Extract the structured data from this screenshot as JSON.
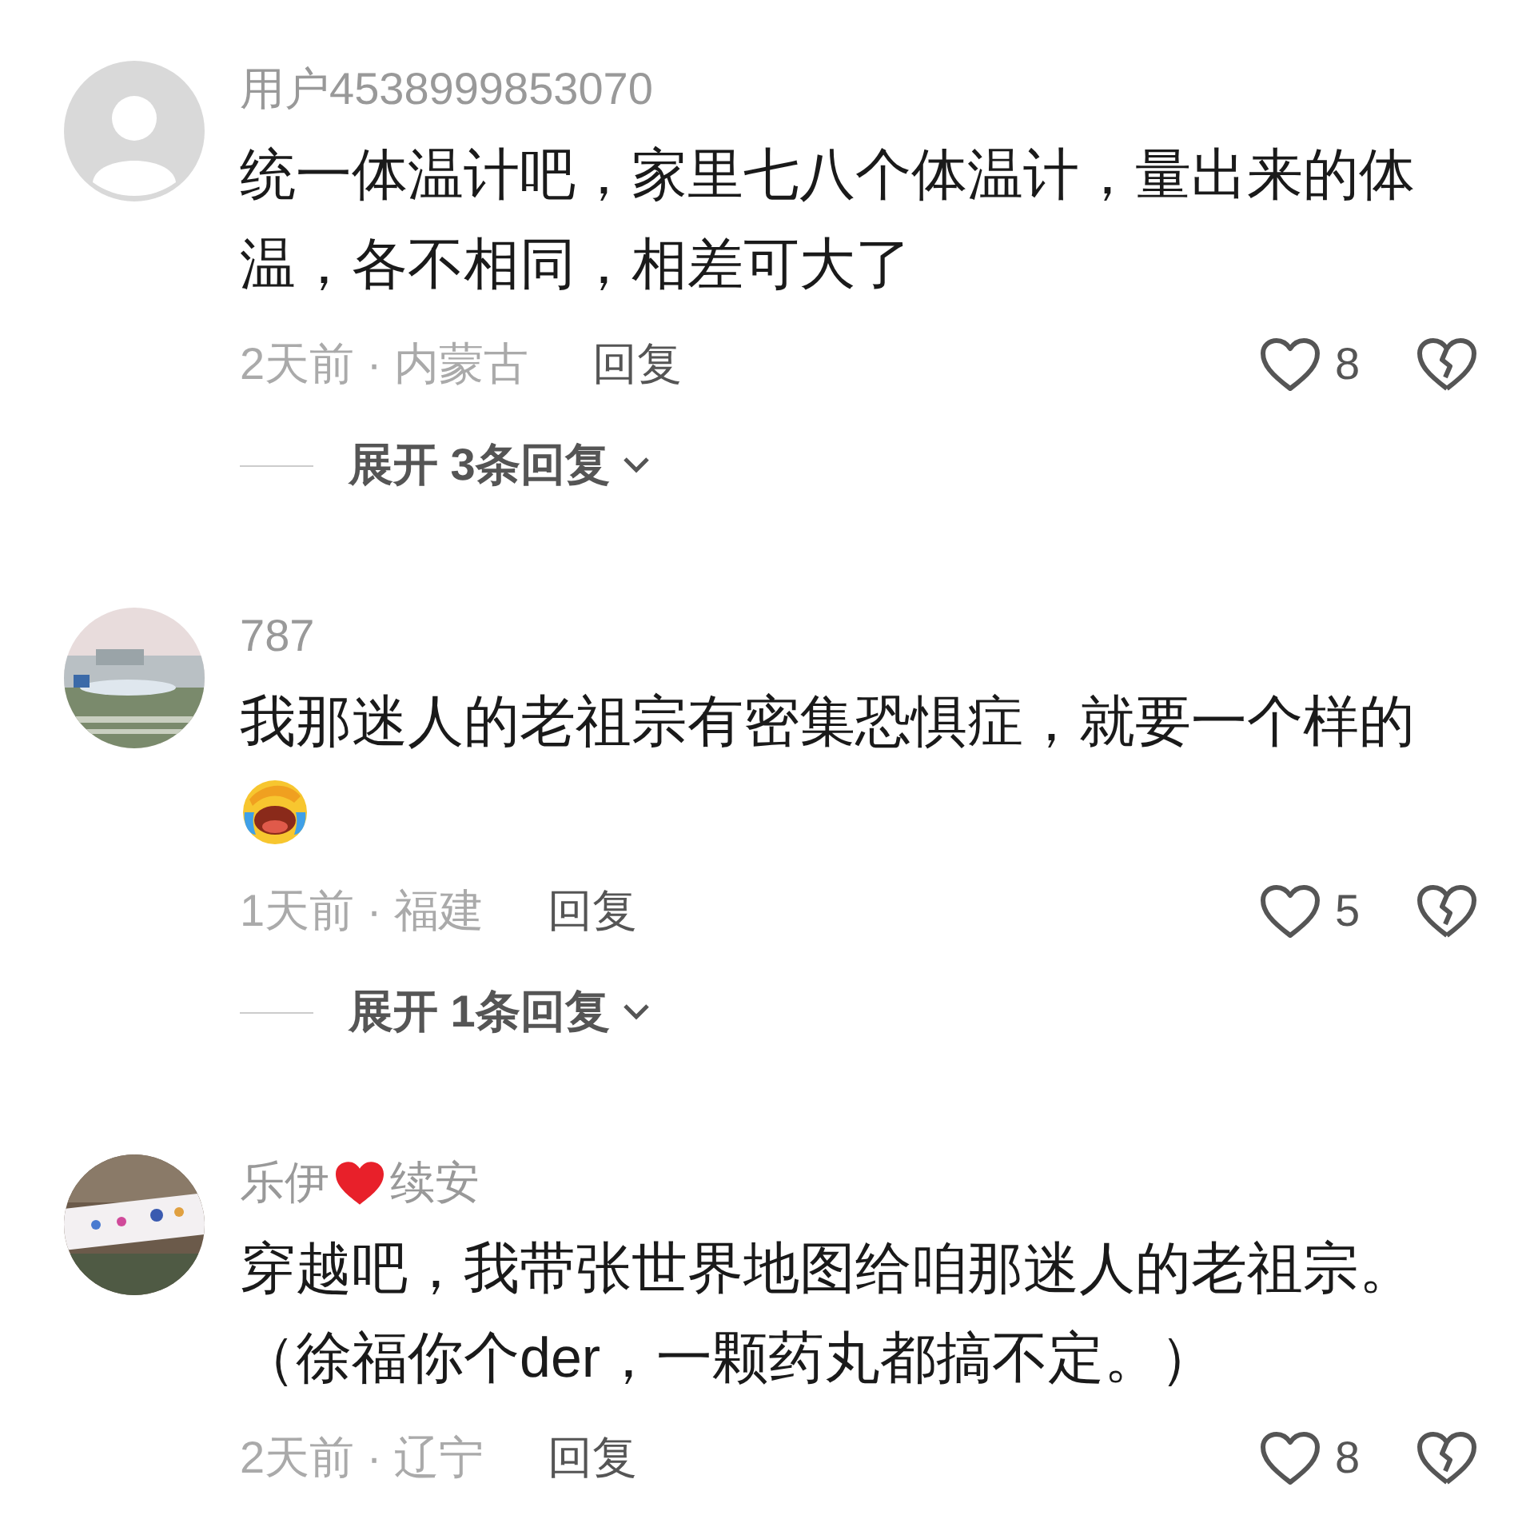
{
  "comments": [
    {
      "avatar": {
        "kind": "default"
      },
      "name": [
        {
          "kind": "text",
          "text": "用户4538999853070"
        }
      ],
      "body": "统一体温计吧，家里七八个体温计，量出来的体温，各不相同，相差可大了",
      "emoji": false,
      "meta": "2天前 · 内蒙古",
      "reply": "回复",
      "likes": "8",
      "expand": "展开 3条回复"
    },
    {
      "name": [
        {
          "kind": "text",
          "text": "787"
        }
      ],
      "body": "我那迷人的老祖宗有密集恐惧症，就要一个样的",
      "emoji": true,
      "meta": "1天前 · 福建",
      "reply": "回复",
      "likes": "5",
      "expand": "展开 1条回复"
    },
    {
      "name": [
        {
          "kind": "text",
          "text": "乐伊"
        },
        {
          "kind": "heart"
        },
        {
          "kind": "text",
          "text": "续安"
        }
      ],
      "body": "穿越吧，我带张世界地图给咱那迷人的老祖宗。（徐福你个der，一颗药丸都搞不定。）",
      "emoji": false,
      "meta": "2天前 · 辽宁",
      "reply": "回复",
      "likes": "8"
    }
  ]
}
